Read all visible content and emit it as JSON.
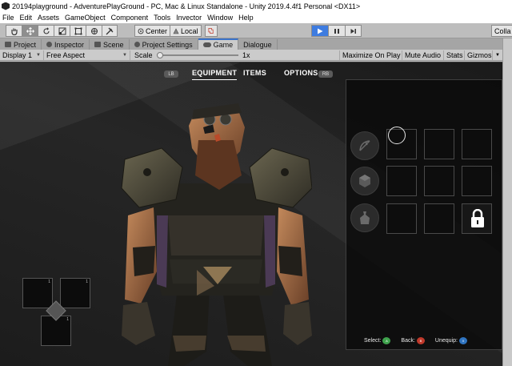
{
  "window": {
    "title": "20194playground - AdventurePlayGround - PC, Mac & Linux Standalone - Unity 2019.4.4f1 Personal <DX11>"
  },
  "menu": [
    "File",
    "Edit",
    "Assets",
    "GameObject",
    "Component",
    "Tools",
    "Invector",
    "Window",
    "Help"
  ],
  "toolbar": {
    "tools": [
      "hand-icon",
      "move-icon",
      "rotate-icon",
      "scale-icon",
      "rect-icon",
      "transform-icon",
      "custom-tool-icon"
    ],
    "pivot_label": "Center",
    "space_label": "Local",
    "collab_label": "Colla"
  },
  "tabs": [
    {
      "label": "Project",
      "icon": "folder-icon"
    },
    {
      "label": "Inspector",
      "icon": "info-icon"
    },
    {
      "label": "Scene",
      "icon": "scene-icon"
    },
    {
      "label": "Project Settings",
      "icon": "gear-icon"
    },
    {
      "label": "Game",
      "icon": "game-icon"
    },
    {
      "label": "Dialogue",
      "icon": ""
    }
  ],
  "gamebar": {
    "display": "Display 1",
    "aspect": "Free Aspect",
    "scale_label": "Scale",
    "scale_value": "1x",
    "maximize": "Maximize On Play",
    "mute": "Mute Audio",
    "stats": "Stats",
    "gizmos": "Gizmos"
  },
  "game": {
    "left_badge": "LB",
    "right_badge": "RB",
    "nav_tabs": [
      "EQUIPMENT",
      "ITEMS",
      "OPTIONS"
    ],
    "active_tab": "EQUIPMENT",
    "categories": [
      "weapon-category-icon",
      "armor-category-icon",
      "consumable-category-icon"
    ],
    "quick_slot_numbers": [
      "1",
      "1",
      "1"
    ],
    "hints": [
      {
        "label": "Select:",
        "button": "A",
        "color": "#3fa34d"
      },
      {
        "label": "Back:",
        "button": "B",
        "color": "#c0392b"
      },
      {
        "label": "Unequip:",
        "button": "X",
        "color": "#2f74c0"
      }
    ]
  }
}
